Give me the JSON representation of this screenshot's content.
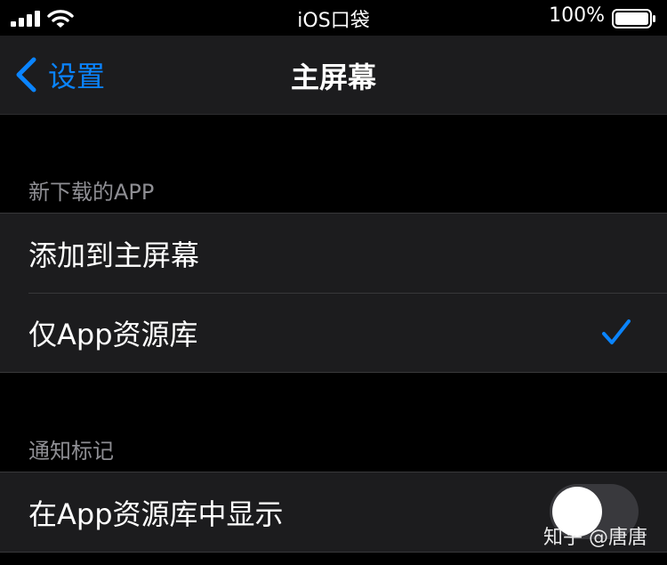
{
  "status_bar": {
    "carrier": "iOS口袋",
    "battery_percent": "100%",
    "signal_icon": "signal-bars-icon",
    "wifi_icon": "wifi-icon",
    "battery_icon": "battery-full-icon"
  },
  "nav": {
    "back_label": "设置",
    "back_icon": "chevron-left-icon",
    "title": "主屏幕"
  },
  "sections": [
    {
      "header": "新下载的APP",
      "rows": [
        {
          "label": "添加到主屏幕",
          "selected": false
        },
        {
          "label": "仅App资源库",
          "selected": true
        }
      ]
    },
    {
      "header": "通知标记",
      "rows": [
        {
          "label": "在App资源库中显示",
          "toggle_on": false
        }
      ]
    }
  ],
  "watermark": "知乎 @唐唐",
  "colors": {
    "accent": "#0a84ff",
    "background": "#000000",
    "cell_background": "#1c1c1e",
    "secondary_text": "#8e8e93",
    "toggle_off": "#39393d"
  }
}
